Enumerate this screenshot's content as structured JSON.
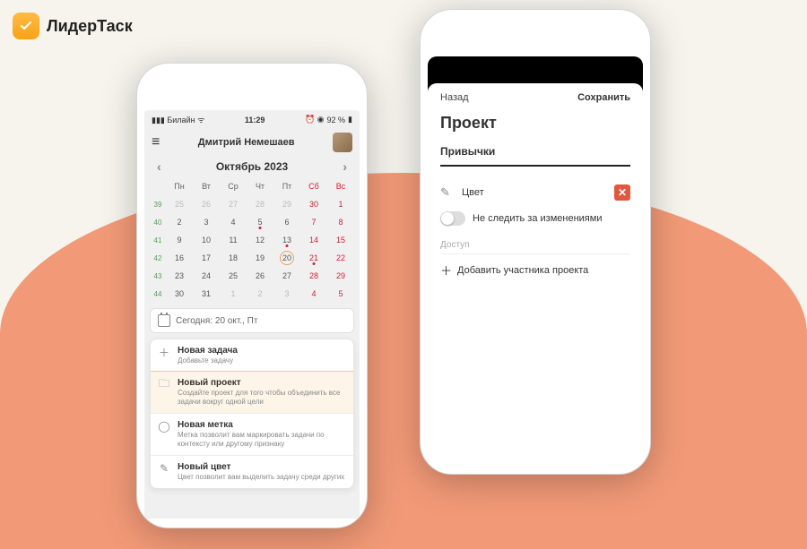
{
  "brand": {
    "name": "ЛидерТаск"
  },
  "phone1": {
    "statusbar": {
      "carrier": "Билайн",
      "time": "11:29",
      "battery": "92 %"
    },
    "user": "Дмитрий Немешаев",
    "month": "Октябрь 2023",
    "dayHeaders": [
      "Пн",
      "Вт",
      "Ср",
      "Чт",
      "Пт",
      "Сб",
      "Вс"
    ],
    "weeks": [
      {
        "wk": "39",
        "days": [
          {
            "n": "25",
            "dim": true
          },
          {
            "n": "26",
            "dim": true
          },
          {
            "n": "27",
            "dim": true
          },
          {
            "n": "28",
            "dim": true
          },
          {
            "n": "29",
            "dim": true
          },
          {
            "n": "30",
            "dim": true,
            "we": true
          },
          {
            "n": "1",
            "we": true
          }
        ]
      },
      {
        "wk": "40",
        "days": [
          {
            "n": "2"
          },
          {
            "n": "3"
          },
          {
            "n": "4"
          },
          {
            "n": "5",
            "dot": true
          },
          {
            "n": "6"
          },
          {
            "n": "7",
            "we": true
          },
          {
            "n": "8",
            "we": true
          }
        ]
      },
      {
        "wk": "41",
        "days": [
          {
            "n": "9"
          },
          {
            "n": "10"
          },
          {
            "n": "11"
          },
          {
            "n": "12"
          },
          {
            "n": "13",
            "dot": true
          },
          {
            "n": "14",
            "we": true
          },
          {
            "n": "15",
            "we": true
          }
        ]
      },
      {
        "wk": "42",
        "days": [
          {
            "n": "16"
          },
          {
            "n": "17"
          },
          {
            "n": "18"
          },
          {
            "n": "19"
          },
          {
            "n": "20",
            "sel": true
          },
          {
            "n": "21",
            "we": true,
            "dot": true
          },
          {
            "n": "22",
            "we": true
          }
        ]
      },
      {
        "wk": "43",
        "days": [
          {
            "n": "23"
          },
          {
            "n": "24"
          },
          {
            "n": "25"
          },
          {
            "n": "26"
          },
          {
            "n": "27"
          },
          {
            "n": "28",
            "we": true
          },
          {
            "n": "29",
            "we": true
          }
        ]
      },
      {
        "wk": "44",
        "days": [
          {
            "n": "30"
          },
          {
            "n": "31"
          },
          {
            "n": "1",
            "dim": true
          },
          {
            "n": "2",
            "dim": true
          },
          {
            "n": "3",
            "dim": true
          },
          {
            "n": "4",
            "dim": true,
            "we": true
          },
          {
            "n": "5",
            "dim": true,
            "we": true
          }
        ]
      }
    ],
    "today": "Сегодня: 20 окт., Пт",
    "actions": [
      {
        "icon": "＋",
        "title": "Новая задача",
        "sub": "Добавьте задачу",
        "hl": false
      },
      {
        "icon": "🗀",
        "title": "Новый проект",
        "sub": "Создайте проект для того чтобы объединить все задачи вокруг одной цели",
        "hl": true
      },
      {
        "icon": "◯",
        "title": "Новая метка",
        "sub": "Метка позволит вам маркировать задачи по контексту или другому признаку",
        "hl": false
      },
      {
        "icon": "✎",
        "title": "Новый цвет",
        "sub": "Цвет позволит вам выделить задачу среди других",
        "hl": false
      }
    ]
  },
  "phone2": {
    "back": "Назад",
    "save": "Сохранить",
    "title": "Проект",
    "subtitle": "Привычки",
    "colorLabel": "Цвет",
    "trackLabel": "Не следить за изменениями",
    "accessLabel": "Доступ",
    "addMember": "Добавить участника проекта"
  }
}
